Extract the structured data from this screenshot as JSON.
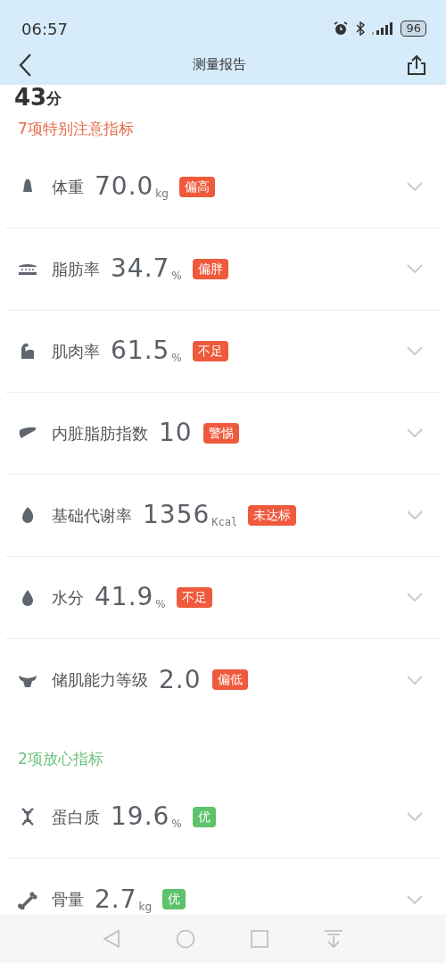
{
  "status_bar": {
    "time": "06:57",
    "battery": "96"
  },
  "header": {
    "title": "测量报告"
  },
  "score": {
    "value": "43",
    "unit": "分"
  },
  "sections": [
    {
      "title": "7项特别注意指标",
      "kind": "attention",
      "items": [
        {
          "name": "体重",
          "value": "70.0",
          "unit": "kg",
          "tag": "偏高"
        },
        {
          "name": "脂肪率",
          "value": "34.7",
          "unit": "%",
          "tag": "偏胖"
        },
        {
          "name": "肌肉率",
          "value": "61.5",
          "unit": "%",
          "tag": "不足"
        },
        {
          "name": "内脏脂肪指数",
          "value": "10",
          "tag": "警惕"
        },
        {
          "name": "基础代谢率",
          "value": "1356",
          "unit": "Kcal",
          "tag": "未达标"
        },
        {
          "name": "水分",
          "value": "41.9",
          "unit": "%",
          "tag": "不足"
        },
        {
          "name": "储肌能力等级",
          "value": "2.0",
          "tag": "偏低"
        }
      ]
    },
    {
      "title": "2项放心指标",
      "kind": "safe",
      "items": [
        {
          "name": "蛋白质",
          "value": "19.6",
          "unit": "%",
          "tag": "优"
        },
        {
          "name": "骨量",
          "value": "2.7",
          "unit": "kg",
          "tag": "优"
        }
      ]
    }
  ]
}
